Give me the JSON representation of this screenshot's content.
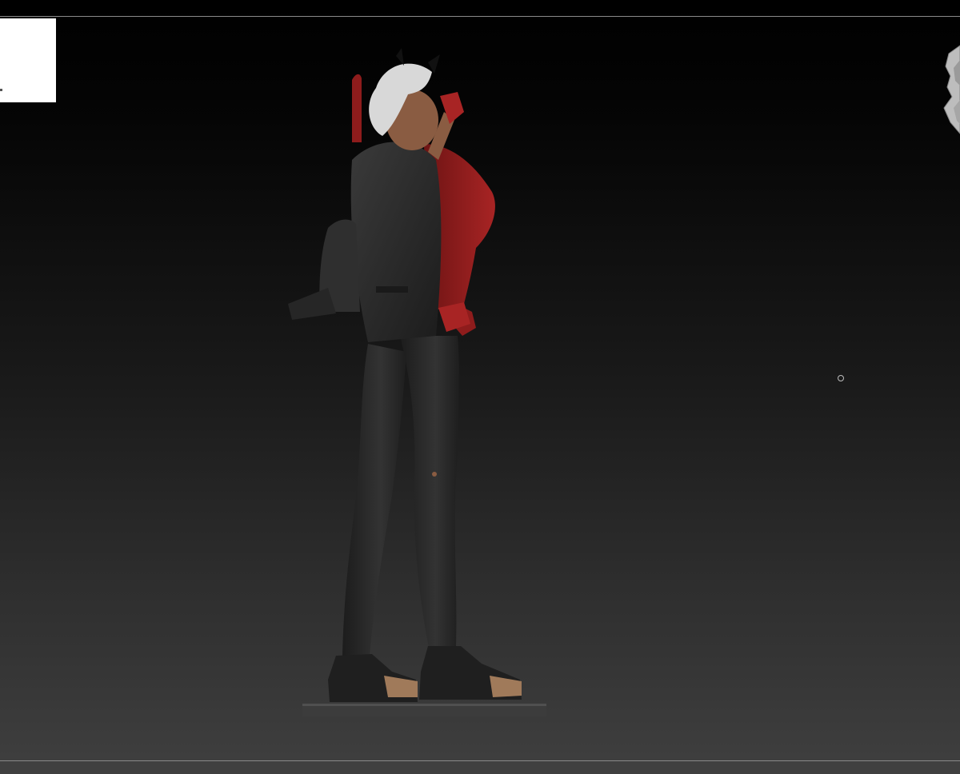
{
  "viewport": {
    "background_top": "#000000",
    "background_bottom": "#3e3e3e",
    "border_color": "#8a8a8a"
  },
  "thumbnail": {
    "color": "#ffffff"
  },
  "model": {
    "colors": {
      "jacket": "#2a2a2a",
      "pants": "#262626",
      "shirt": "#8e1c1c",
      "skin": "#8a5c42",
      "hair": "#d8d8d8",
      "shoes": "#1f1f1f",
      "shoe_toe": "#a07a5a",
      "base": "#3a3a3a"
    }
  },
  "icons": {
    "navigation_gizmo": "navigation-cube-icon",
    "pivot": "pivot-point-icon"
  }
}
